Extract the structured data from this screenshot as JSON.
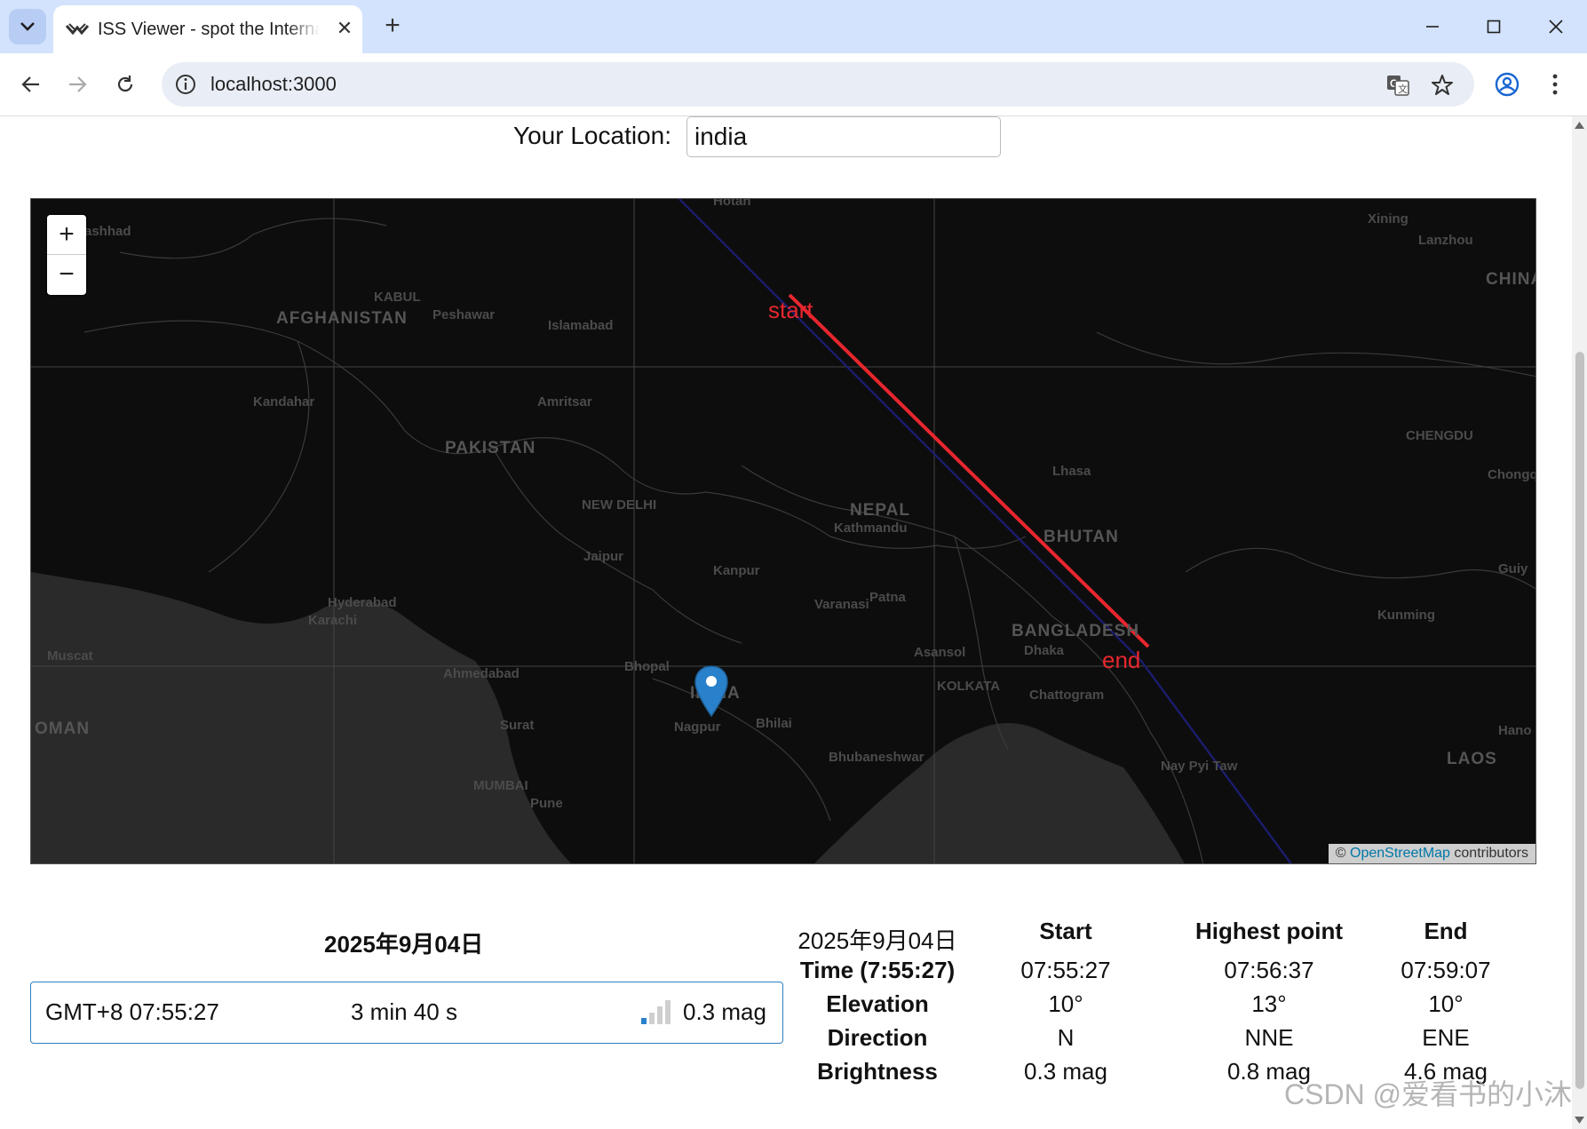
{
  "browser": {
    "tab_title": "ISS Viewer - spot the International Space Station",
    "url": "localhost:3000"
  },
  "location": {
    "label": "Your Location:",
    "value": "india"
  },
  "map": {
    "zoom_in": "+",
    "zoom_out": "−",
    "start_label": "start",
    "end_label": "end",
    "attribution_prefix": "©",
    "attribution_link": "OpenStreetMap",
    "attribution_suffix": "contributors",
    "track_color": "#e8262e",
    "marker_color": "#2a81cb",
    "labels": {
      "hotan": "Hotan",
      "mashhad": "ashhad",
      "xining": "Xining",
      "lanzhou": "Lanzhou",
      "china": "CHINA",
      "kabul": "KABUL",
      "afghanistan": "AFGHANISTAN",
      "peshawar": "Peshawar",
      "islamabad": "Islamabad",
      "kandahar": "Kandahar",
      "amritsar": "Amritsar",
      "pakistan": "PAKISTAN",
      "chengdu": "CHENGDU",
      "lhasa": "Lhasa",
      "chongqing": "Chongq",
      "new_delhi": "NEW DELHI",
      "nepal": "NEPAL",
      "kathmandu": "Kathmandu",
      "bhutan": "BHUTAN",
      "jaipur": "Jaipur",
      "kanpur": "Kanpur",
      "guiyang": "Guiy",
      "hyderabad": "Hyderabad",
      "karachi": "Karachi",
      "varanasi": "Varanasi",
      "patna": "Patna",
      "kunming": "Kunming",
      "bangladesh": "BANGLADESH",
      "dhaka": "Dhaka",
      "muscat": "Muscat",
      "bhopal": "Bhopal",
      "asansol": "Asansol",
      "ahmedabad": "Ahmedabad",
      "india": "INDIA",
      "kolkata": "KOLKATA",
      "chattogram": "Chattogram",
      "oman": "OMAN",
      "surat": "Surat",
      "nagpur": "Nagpur",
      "bhilai": "Bhilai",
      "hanoi": "Hano",
      "bhubaneshwar": "Bhubaneshwar",
      "laos": "LAOS",
      "mumbai": "MUMBAI",
      "pune": "Pune",
      "nay_pyi_taw": "Nay Pyi Taw"
    }
  },
  "pass_summary": {
    "date": "2025年9月04日",
    "time": "GMT+8 07:55:27",
    "duration": "3 min 40 s",
    "magnitude": "0.3 mag"
  },
  "pass_details": {
    "date": "2025年9月04日",
    "columns": [
      "Start",
      "Highest point",
      "End"
    ],
    "rows": [
      {
        "label": "Time (7:55:27)",
        "values": [
          "07:55:27",
          "07:56:37",
          "07:59:07"
        ]
      },
      {
        "label": "Elevation",
        "values": [
          "10°",
          "13°",
          "10°"
        ]
      },
      {
        "label": "Direction",
        "values": [
          "N",
          "NNE",
          "ENE"
        ]
      },
      {
        "label": "Brightness",
        "values": [
          "0.3 mag",
          "0.8 mag",
          "4.6 mag"
        ]
      }
    ]
  },
  "watermark": "CSDN @爱看书的小沐"
}
